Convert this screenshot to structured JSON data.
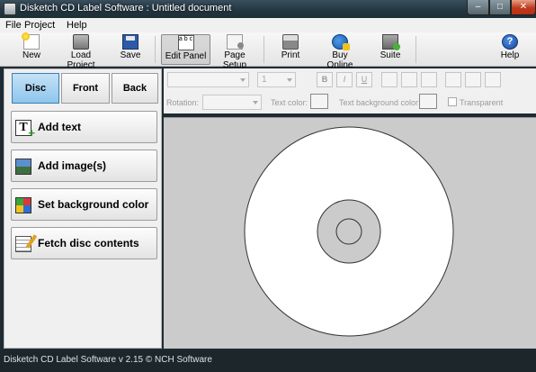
{
  "window": {
    "title": "Disketch CD Label Software : Untitled document",
    "controls": {
      "minimize": "–",
      "maximize": "□",
      "close": "✕"
    }
  },
  "menu": [
    "File",
    "Project",
    "Help"
  ],
  "toolbar": {
    "new": "New",
    "load_project": "Load Project",
    "save": "Save",
    "edit_panel": "Edit Panel",
    "page_setup": "Page Setup",
    "print": "Print",
    "buy_online": "Buy Online",
    "suite": "Suite",
    "help": "Help",
    "edit_panel_icon_text": "a b c"
  },
  "sides": {
    "disc": "Disc",
    "front": "Front",
    "back": "Back",
    "active": "Disc"
  },
  "actions": {
    "add_text": "Add text",
    "add_images": "Add image(s)",
    "set_background": "Set background color",
    "fetch_disc": "Fetch disc contents"
  },
  "format": {
    "font_size": "1",
    "bold": "B",
    "italic": "I",
    "underline": "U",
    "rotation_label": "Rotation:",
    "text_color_label": "Text color:",
    "text_bg_color_label": "Text background color:",
    "transparent_label": "Transparent"
  },
  "status": {
    "text": "Disketch CD Label Software v 2.15 © NCH Software"
  }
}
